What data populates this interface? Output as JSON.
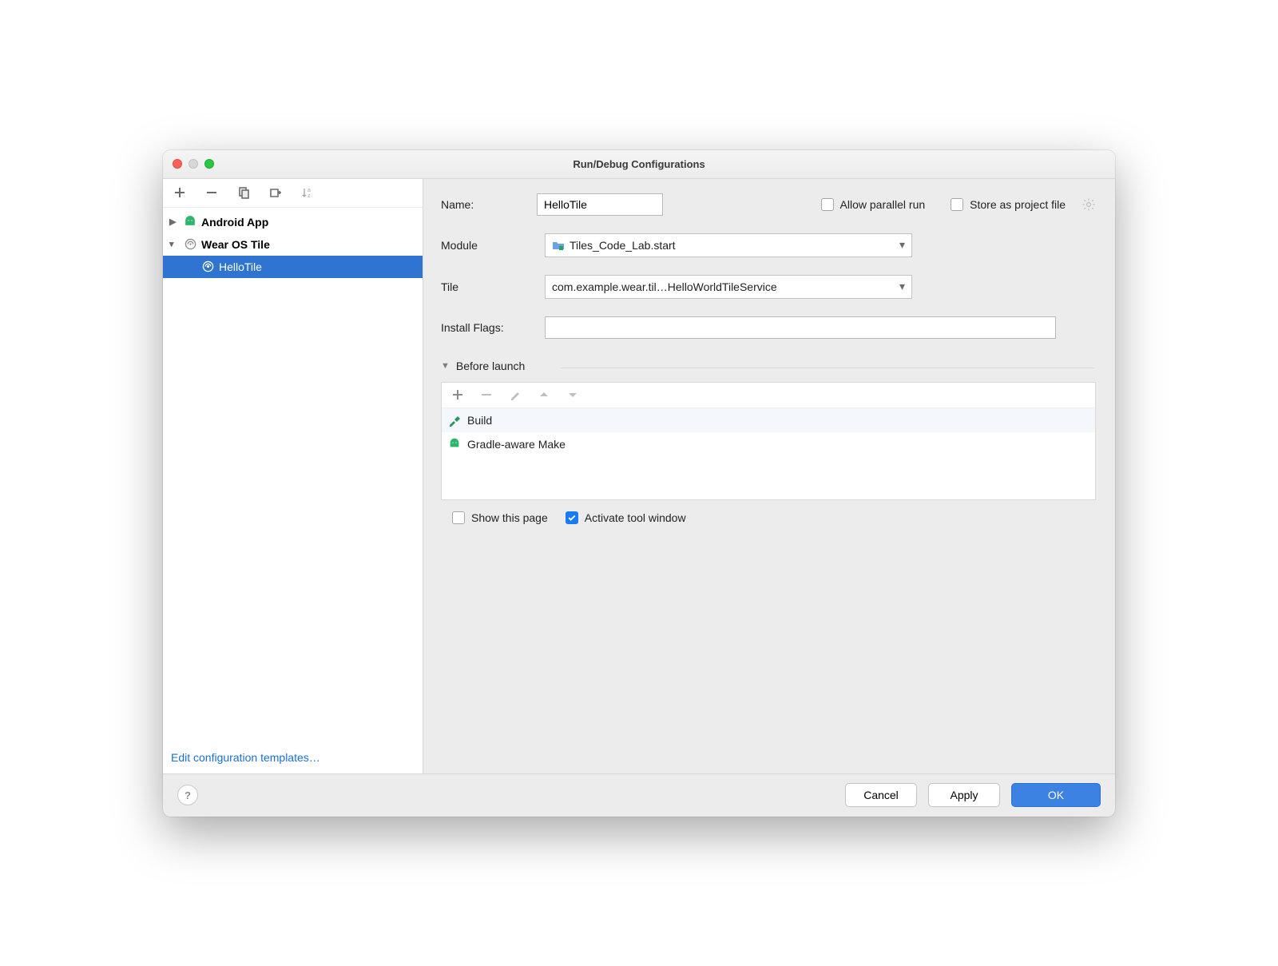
{
  "window": {
    "title": "Run/Debug Configurations"
  },
  "sidebar": {
    "nodes": {
      "androidApp": {
        "label": "Android App"
      },
      "wearTile": {
        "label": "Wear OS Tile"
      },
      "helloTile": {
        "label": "HelloTile"
      }
    },
    "footerLink": "Edit configuration templates…"
  },
  "form": {
    "nameLabel": "Name:",
    "nameValue": "HelloTile",
    "allowParallel": {
      "label": "Allow parallel run",
      "checked": false
    },
    "storeProject": {
      "label": "Store as project file",
      "checked": false
    },
    "moduleLabel": "Module",
    "moduleValue": "Tiles_Code_Lab.start",
    "tileLabel": "Tile",
    "tileValue": "com.example.wear.til…HelloWorldTileService",
    "installFlagsLabel": "Install Flags:",
    "installFlagsValue": ""
  },
  "beforeLaunch": {
    "title": "Before launch",
    "items": [
      {
        "label": "Build",
        "icon": "hammer"
      },
      {
        "label": "Gradle-aware Make",
        "icon": "android"
      }
    ],
    "showPage": {
      "label": "Show this page",
      "checked": false
    },
    "toolWindow": {
      "label": "Activate tool window",
      "checked": true
    }
  },
  "footer": {
    "cancel": "Cancel",
    "apply": "Apply",
    "ok": "OK"
  }
}
